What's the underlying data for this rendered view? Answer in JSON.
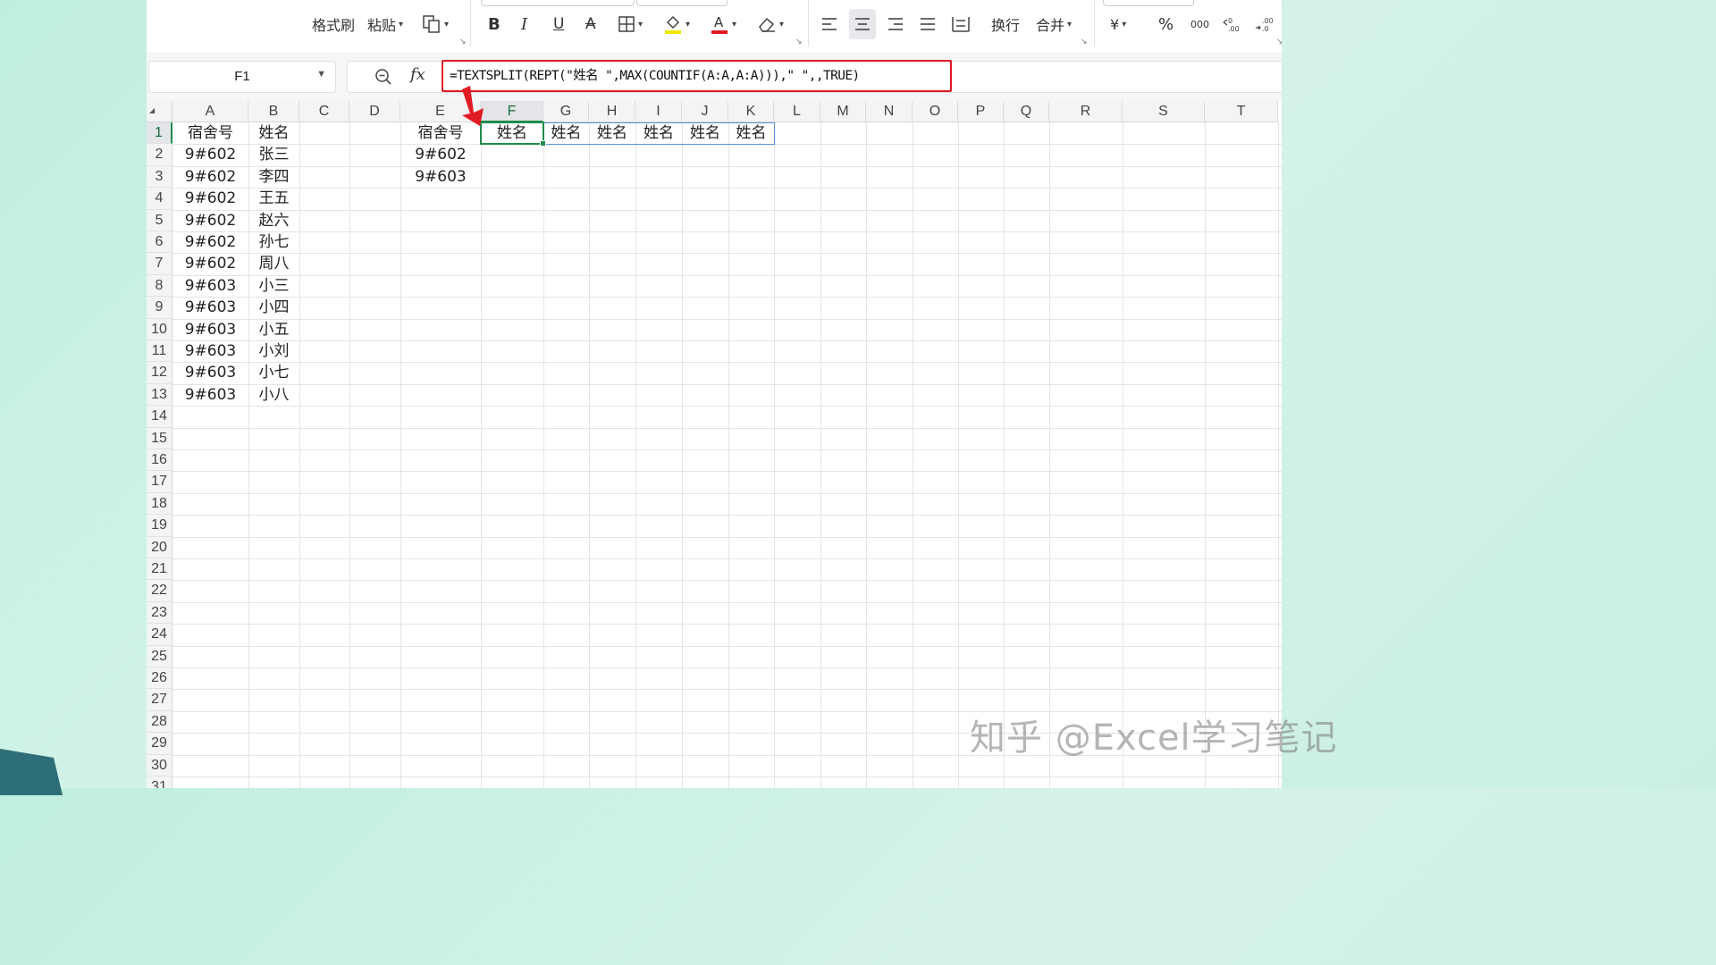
{
  "ribbon": {
    "format_painter": "格式刷",
    "paste": "粘贴",
    "bold": "B",
    "italic": "I",
    "underline": "U",
    "strikethrough": "A",
    "wrap_text": "换行",
    "merge": "合并",
    "currency": "¥",
    "percent": "%",
    "thousands": "000"
  },
  "formula_bar": {
    "name_box": "F1",
    "fx": "fx",
    "formula": "=TEXTSPLIT(REPT(\"姓名 \",MAX(COUNTIF(A:A,A:A))),\" \",,TRUE)"
  },
  "columns": [
    "A",
    "B",
    "C",
    "D",
    "E",
    "F",
    "G",
    "H",
    "I",
    "J",
    "K",
    "L",
    "M",
    "N",
    "O",
    "P",
    "Q",
    "R",
    "S",
    "T"
  ],
  "rows": [
    "1",
    "2",
    "3",
    "4",
    "5",
    "6",
    "7",
    "8",
    "9",
    "10",
    "11",
    "12",
    "13",
    "14",
    "15",
    "16",
    "17",
    "18",
    "19",
    "20",
    "21",
    "22",
    "23",
    "24",
    "25",
    "26",
    "27",
    "28",
    "29",
    "30",
    "31"
  ],
  "cells": {
    "col_a": [
      "宿舍号",
      "9#602",
      "9#602",
      "9#602",
      "9#602",
      "9#602",
      "9#602",
      "9#603",
      "9#603",
      "9#603",
      "9#603",
      "9#603",
      "9#603"
    ],
    "col_b": [
      "姓名",
      "张三",
      "李四",
      "王五",
      "赵六",
      "孙七",
      "周八",
      "小三",
      "小四",
      "小五",
      "小刘",
      "小七",
      "小八"
    ],
    "col_e": [
      "宿舍号",
      "9#602",
      "9#603"
    ],
    "row1_spill": [
      "姓名",
      "姓名",
      "姓名",
      "姓名",
      "姓名",
      "姓名"
    ]
  },
  "active_cell": "F1",
  "watermark": "知乎 @Excel学习笔记",
  "colors": {
    "selection": "#1f8b4c",
    "highlight_box": "#e01b24",
    "spill_border": "#5b8fd6",
    "background": "#c9efe4"
  }
}
